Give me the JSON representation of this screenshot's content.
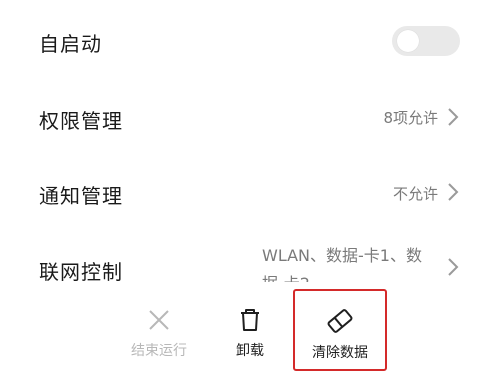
{
  "settings": {
    "autostart": {
      "label": "自启动",
      "enabled": false
    },
    "permissions": {
      "label": "权限管理",
      "value": "8项允许"
    },
    "notifications": {
      "label": "通知管理",
      "value": "不允许"
    },
    "network": {
      "label": "联网控制",
      "value": "WLAN、数据-卡1、数据-卡2"
    }
  },
  "actions": {
    "stop": {
      "label": "结束运行",
      "icon": "close-x-icon",
      "enabled": false
    },
    "uninstall": {
      "label": "卸载",
      "icon": "trash-icon"
    },
    "clear_data": {
      "label": "清除数据",
      "icon": "eraser-icon"
    }
  },
  "colors": {
    "highlight": "#d42a2a",
    "disabled": "#b8b8b8",
    "secondary": "#7a7a7a"
  }
}
